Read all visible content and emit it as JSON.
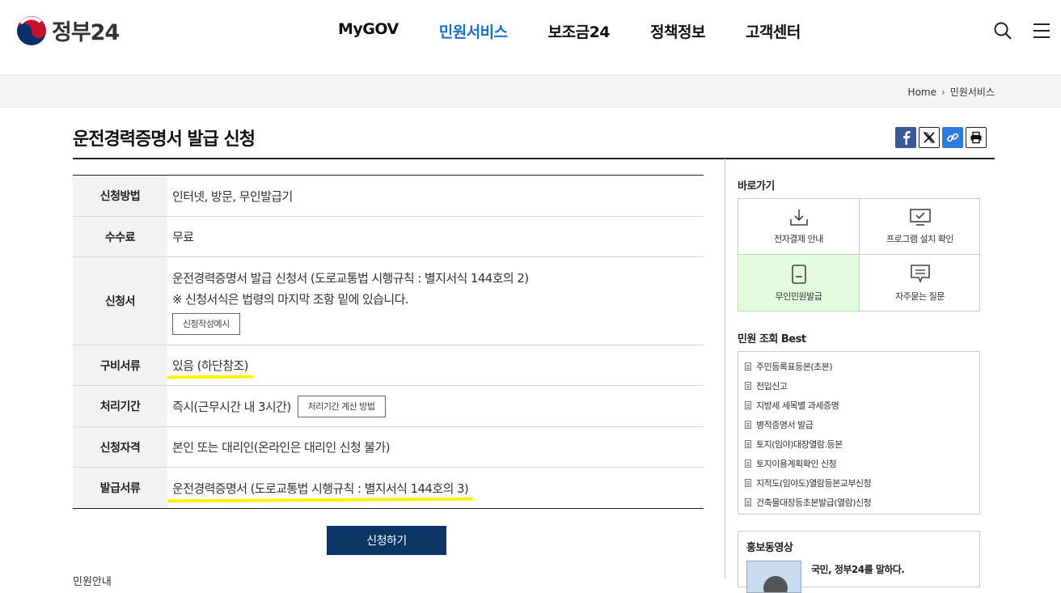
{
  "header": {
    "logo_text": "정부24",
    "nav": [
      "MyGOV",
      "민원서비스",
      "보조금24",
      "정책정보",
      "고객센터"
    ],
    "active_nav": "민원서비스"
  },
  "breadcrumb": {
    "home": "Home",
    "current": "민원서비스"
  },
  "page": {
    "title": "운전경력증명서 발급 신청"
  },
  "info": {
    "method": {
      "label": "신청방법",
      "value": "인터넷, 방문, 무인발급기"
    },
    "fee": {
      "label": "수수료",
      "value": "무료"
    },
    "form": {
      "label": "신청서",
      "line1": "운전경력증명서 발급 신청서 (도로교통법 시행규칙 : 별지서식 144호의 2)",
      "line2": "※ 신청서식은 법령의 마지막 조항 밑에 있습니다.",
      "button": "신청작성예시"
    },
    "docs": {
      "label": "구비서류",
      "value": "있음 (하단참조)"
    },
    "period": {
      "label": "처리기간",
      "value": "즉시(근무시간 내 3시간)",
      "button": "처리기간 계산 방법"
    },
    "eligibility": {
      "label": "신청자격",
      "value": "본인 또는 대리인(온라인은 대리인 신청 불가)"
    },
    "issued": {
      "label": "발급서류",
      "value": "운전경력증명서 (도로교통법 시행규칙 : 별지서식 144호의 3)"
    }
  },
  "apply_button": "신청하기",
  "cutoff_text": "민원안내",
  "sidebar": {
    "quick_title": "바로가기",
    "quick": [
      {
        "label": "전자결제 안내",
        "icon": "download-icon"
      },
      {
        "label": "프로그램 설치 확인",
        "icon": "monitor-check-icon"
      },
      {
        "label": "무인민원발급",
        "icon": "kiosk-icon"
      },
      {
        "label": "자주묻는 질문",
        "icon": "chat-icon"
      }
    ],
    "best_title": "민원 조회 Best",
    "best": [
      "주민등록표등본(초본)",
      "전입신고",
      "지방세 세목별 과세증명",
      "병적증명서 발급",
      "토지(임야)대장열람.등본",
      "토지이용계획확인 신청",
      "지적도(임야도)열람등본교부신청",
      "건축물대장등초본발급(열람)신청"
    ],
    "promo_title": "홍보동영상",
    "promo_text": "국민, 정부24를 말하다."
  },
  "colors": {
    "accent": "#1a6fc9",
    "apply": "#0c3666",
    "highlight": "#fff200"
  }
}
